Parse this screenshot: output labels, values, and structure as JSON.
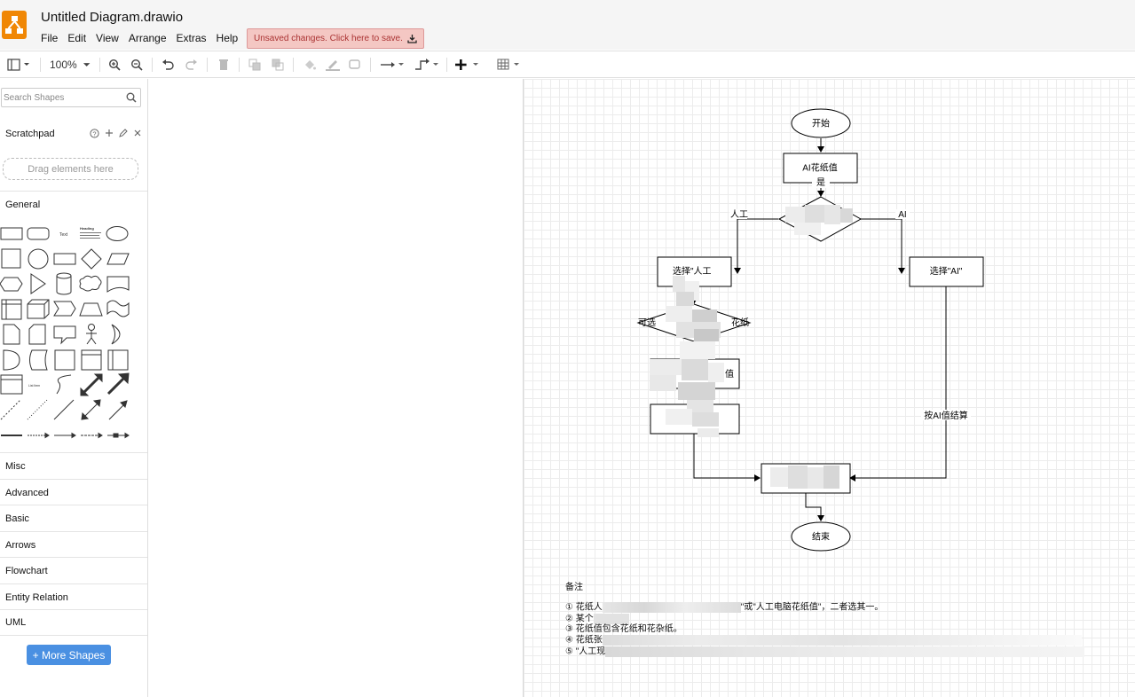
{
  "app": {
    "title": "Untitled Diagram.drawio",
    "menu": [
      "File",
      "Edit",
      "View",
      "Arrange",
      "Extras",
      "Help"
    ],
    "unsaved_notice": "Unsaved changes. Click here to save."
  },
  "toolbar": {
    "zoom": "100%"
  },
  "sidebar": {
    "search_placeholder": "Search Shapes",
    "scratchpad": "Scratchpad",
    "drop_hint": "Drag elements here",
    "general": "General",
    "sections": [
      "Misc",
      "Advanced",
      "Basic",
      "Arrows",
      "Flowchart",
      "Entity Relation",
      "UML"
    ],
    "more_shapes": "+ More Shapes",
    "shape_text_labels": [
      "Text",
      "Heading",
      "List Item"
    ]
  },
  "diagram": {
    "start": "开始",
    "ai_value": "AI花纸值",
    "yes": "是",
    "left_branch": "人工",
    "right_branch": "AI",
    "select_manual": "选择\"人工",
    "select_ai": "选择\"AI\"",
    "optional_left": "可选",
    "optional_right": "花纸",
    "value_suffix": "值",
    "settle_by_ai": "按AI值结算",
    "end": "结束"
  },
  "notes": {
    "title": "备注",
    "lines": [
      "① 花纸人",
      "\"或\"人工电脑花纸值\"，二者选其一。",
      "② 某个",
      "③ 花纸值包含花纸和花杂纸。",
      "④ 花纸张",
      "⑤ \"人工现"
    ]
  },
  "colors": {
    "accent": "#f08705",
    "unsaved_bg": "#f4c7c3",
    "more_shapes_bg": "#4a90e2"
  }
}
